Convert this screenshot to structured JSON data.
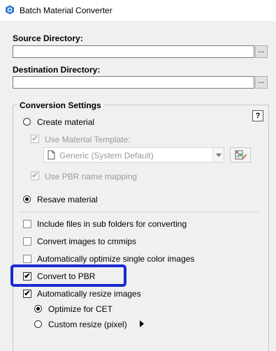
{
  "window": {
    "title": "Batch Material Converter"
  },
  "source": {
    "label": "Source Directory:",
    "value": "",
    "browse_label": "..."
  },
  "destination": {
    "label": "Destination Directory:",
    "value": "",
    "browse_label": "..."
  },
  "conversion_settings": {
    "title": "Conversion Settings",
    "help_label": "?",
    "create_material": {
      "label": "Create material",
      "selected": false
    },
    "use_material_template": {
      "label": "Use Material Template:",
      "checked": true,
      "enabled": false
    },
    "template_select": {
      "value": "Generic (System Default)",
      "enabled": false
    },
    "use_pbr_name_mapping": {
      "label": "Use PBR name mapping",
      "checked": true,
      "enabled": false
    },
    "resave_material": {
      "label": "Resave material",
      "selected": true
    }
  },
  "options": {
    "include_sub_folders": {
      "label": "Include files in sub folders for converting",
      "checked": false
    },
    "convert_cmmips": {
      "label": "Convert images to cmmips",
      "checked": false
    },
    "optimize_single_color": {
      "label": "Automatically optimize single color images",
      "checked": false
    },
    "convert_pbr": {
      "label": "Convert to PBR",
      "checked": true
    },
    "auto_resize": {
      "label": "Automatically resize images",
      "checked": true
    },
    "optimize_cet": {
      "label": "Optimize for CET",
      "selected": true
    },
    "custom_resize": {
      "label": "Custom resize (pixel)",
      "selected": false
    }
  },
  "highlight_color": "#1a2bd1"
}
